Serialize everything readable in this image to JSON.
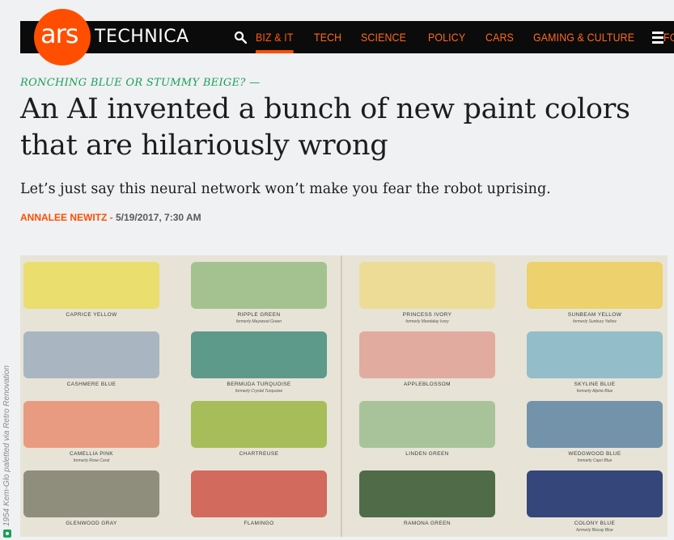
{
  "header": {
    "logo_ars": "ars",
    "logo_technica": "TECHNICA",
    "nav": [
      "BIZ & IT",
      "TECH",
      "SCIENCE",
      "POLICY",
      "CARS",
      "GAMING & CULTURE",
      "FORUMS"
    ],
    "active_nav": "BIZ & IT"
  },
  "article": {
    "kicker": "RONCHING BLUE OR STUMMY BEIGE? —",
    "title": "An AI invented a bunch of new paint colors that are hilariously wrong",
    "dek": "Let’s just say this neural network won’t make you fear the robot uprising.",
    "author": "ANNALEE NEWITZ",
    "separator": " - ",
    "date": "5/19/2017, 7:30 AM"
  },
  "image": {
    "credit": "1954 Kem-Glo paletted via Retro Renovation",
    "swatches": [
      {
        "name": "CAPRICE YELLOW",
        "sub": "",
        "color": "#e9de6e"
      },
      {
        "name": "RIPPLE GREEN",
        "sub": "formerly Maywood Green",
        "color": "#a3c28f"
      },
      {
        "name": "PRINCESS IVORY",
        "sub": "formerly Mandalay Ivory",
        "color": "#eddc96"
      },
      {
        "name": "SUNBEAM YELLOW",
        "sub": "formerly Sunbury Yellow",
        "color": "#ecd16c"
      },
      {
        "name": "CASHMERE BLUE",
        "sub": "",
        "color": "#a9b6c1"
      },
      {
        "name": "BERMUDA TURQUOISE",
        "sub": "formerly Crystal Turquoise",
        "color": "#5d9a8a"
      },
      {
        "name": "APPLEBLOSSOM",
        "sub": "",
        "color": "#e1aba0"
      },
      {
        "name": "SKYLINE BLUE",
        "sub": "formerly Alpine Blue",
        "color": "#92bdc9"
      },
      {
        "name": "CAMELLIA PINK",
        "sub": "formerly Rose Coral",
        "color": "#e99b81"
      },
      {
        "name": "CHARTREUSE",
        "sub": "",
        "color": "#a6bd5a"
      },
      {
        "name": "LINDEN GREEN",
        "sub": "",
        "color": "#a8c39a"
      },
      {
        "name": "WEDGWOOD BLUE",
        "sub": "formerly Capri Blue",
        "color": "#7393ab"
      },
      {
        "name": "GLENWOOD GRAY",
        "sub": "",
        "color": "#8f8d7c"
      },
      {
        "name": "FLAMINGO",
        "sub": "",
        "color": "#d26a5e"
      },
      {
        "name": "RAMONA GREEN",
        "sub": "",
        "color": "#506b48"
      },
      {
        "name": "COLONY BLUE",
        "sub": "formerly Biscay Blue",
        "color": "#35467a"
      }
    ]
  }
}
